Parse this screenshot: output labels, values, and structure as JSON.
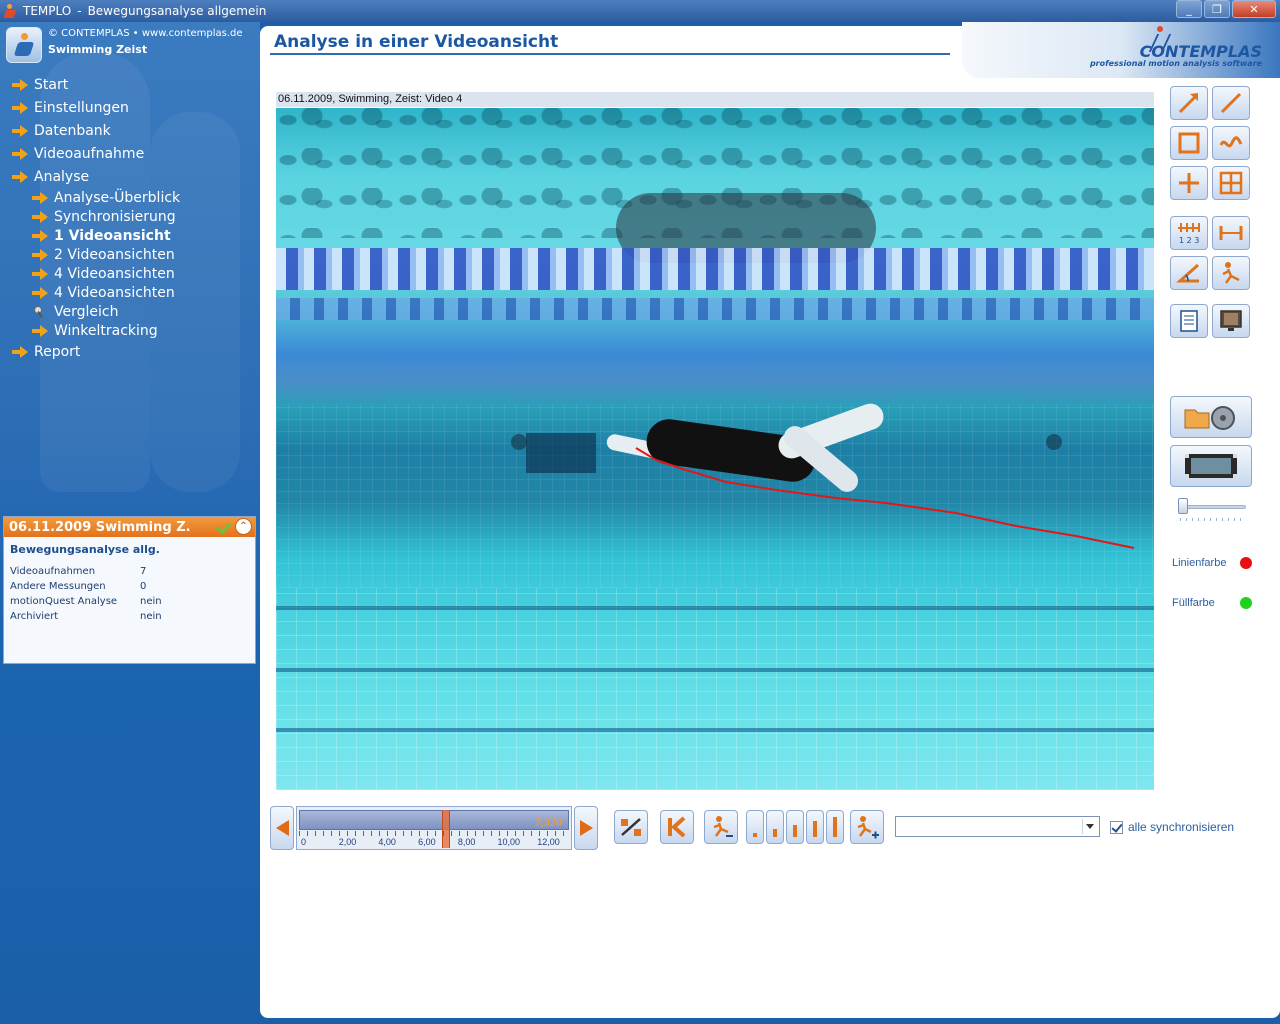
{
  "window": {
    "app": "TEMPLO",
    "title": "Bewegungsanalyse allgemein",
    "buttons": [
      "_",
      "❐",
      "✕"
    ]
  },
  "sidebar": {
    "copyright": "© CONTEMPLAS • www.contemplas.de",
    "org": "Swimming Zeist",
    "nav": [
      {
        "label": "Start",
        "level": 0
      },
      {
        "label": "Einstellungen",
        "level": 0
      },
      {
        "label": "Datenbank",
        "level": 0
      },
      {
        "label": "Videoaufnahme",
        "level": 0
      },
      {
        "label": "Analyse",
        "level": 0
      },
      {
        "label": "Analyse-Überblick",
        "level": 1
      },
      {
        "label": "Synchronisierung",
        "level": 1
      },
      {
        "label": "1 Videoansicht",
        "level": 1,
        "active": true
      },
      {
        "label": "2 Videoansichten",
        "level": 1
      },
      {
        "label": "4 Videoansichten",
        "level": 1
      },
      {
        "label": "4 Videoansichten",
        "level": 1
      },
      {
        "label": "Vergleich",
        "level": 1,
        "icon": "pin-icon"
      },
      {
        "label": "Winkeltracking",
        "level": 1
      },
      {
        "label": "Report",
        "level": 0
      }
    ]
  },
  "info": {
    "header": "06.11.2009 Swimming Z.",
    "collapse": "⌃",
    "title": "Bewegungsanalyse allg.",
    "rows": [
      {
        "key": "Videoaufnahmen",
        "value": "7"
      },
      {
        "key": "Andere Messungen",
        "value": "0"
      },
      {
        "key": "motionQuest Analyse",
        "value": "nein"
      },
      {
        "key": "Archiviert",
        "value": "nein"
      }
    ]
  },
  "main": {
    "title": "Analyse in einer Videoansicht",
    "brand": "CONTEMPLAS",
    "brand_sub": "professional motion analysis software",
    "video_caption": "06.11.2009, Swimming, Zeist: Video 4"
  },
  "tools": [
    "arrow-tool-icon",
    "line-tool-icon",
    "rectangle-tool-icon",
    "freehand-tool-icon",
    "crosshair-tool-icon",
    "grid-tool-icon",
    "ruler-tool-icon",
    "distance-tool-icon",
    "angle-tool-icon",
    "tracking-tool-icon",
    "report-icon",
    "monitor-icon",
    "open-video-icon",
    "video-strip-icon"
  ],
  "colors": {
    "line_label": "Linienfarbe",
    "line_color": "#e81010",
    "fill_label": "Füllfarbe",
    "fill_color": "#1ed21e",
    "trace_color": "#e01818"
  },
  "timeline": {
    "current_value": "7,320",
    "current": 7.32,
    "range": [
      0,
      13.5
    ],
    "tick_labels": [
      "0",
      "2,00",
      "4,00",
      "6,00",
      "8,00",
      "10,00",
      "12,00"
    ],
    "ticks": [
      0,
      2,
      4,
      6,
      8,
      10,
      12
    ]
  },
  "playback": {
    "dropdown_value": "",
    "sync_label": "alle synchronisieren",
    "sync_checked": true
  }
}
